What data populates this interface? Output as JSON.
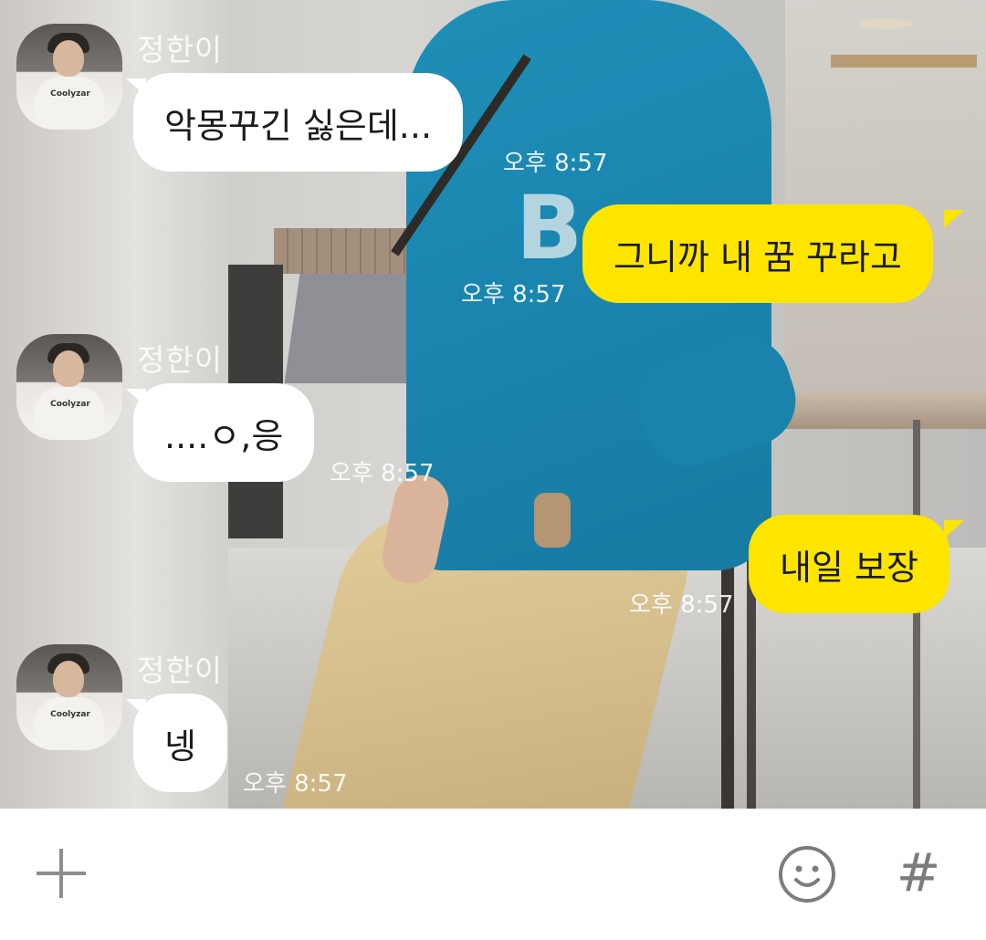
{
  "chat": {
    "messages": [
      {
        "direction": "incoming",
        "sender": "정한이",
        "text": "악몽꾸긴 싫은데...",
        "time": "오후 8:57"
      },
      {
        "direction": "outgoing",
        "text": "그니까 내 꿈 꾸라고",
        "time": "오후 8:57"
      },
      {
        "direction": "incoming",
        "sender": "정한이",
        "text": "....ㅇ,응",
        "time": "오후 8:57"
      },
      {
        "direction": "outgoing",
        "text": "내일 보장",
        "time": "오후 8:57"
      },
      {
        "direction": "incoming",
        "sender": "정한이",
        "text": "넹",
        "time": "오후 8:57"
      }
    ],
    "avatar_shirt_text": "Coolyzar"
  },
  "input_bar": {
    "plus_icon": "plus-icon",
    "emoji_icon": "emoji-icon",
    "hash_icon": "hash-icon",
    "hash_glyph": "#"
  },
  "colors": {
    "outgoing_bubble": "#fee500",
    "incoming_bubble": "#ffffff",
    "icon_gray": "#8d8d8d"
  }
}
